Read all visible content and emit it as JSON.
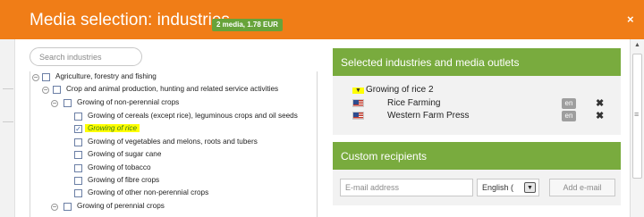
{
  "header": {
    "title": "Media selection: industries",
    "badge": "2 media, 1.78 EUR",
    "close_glyph": "×",
    "background_color": "#f07d17"
  },
  "search": {
    "placeholder": "Search industries"
  },
  "tree": {
    "expand_glyph": "−",
    "check_glyph": "✓",
    "nodes": [
      {
        "label": "Agriculture, forestry and fishing",
        "expander": true,
        "checked": false,
        "selected": false
      },
      {
        "label": "Crop and animal production, hunting and related service activities",
        "expander": true,
        "checked": false,
        "selected": false
      },
      {
        "label": "Growing of non-perennial crops",
        "expander": true,
        "checked": false,
        "selected": false
      },
      {
        "label": "Growing of cereals (except rice), leguminous crops and oil seeds",
        "expander": false,
        "checked": false,
        "selected": false
      },
      {
        "label": "Growing of rice",
        "expander": false,
        "checked": true,
        "selected": true
      },
      {
        "label": "Growing of vegetables and melons, roots and tubers",
        "expander": false,
        "checked": false,
        "selected": false
      },
      {
        "label": "Growing of sugar cane",
        "expander": false,
        "checked": false,
        "selected": false
      },
      {
        "label": "Growing of tobacco",
        "expander": false,
        "checked": false,
        "selected": false
      },
      {
        "label": "Growing of fibre crops",
        "expander": false,
        "checked": false,
        "selected": false
      },
      {
        "label": "Growing of other non-perennial crops",
        "expander": false,
        "checked": false,
        "selected": false
      },
      {
        "label": "Growing of perennial crops",
        "expander": true,
        "checked": false,
        "selected": false
      }
    ]
  },
  "selected_panel": {
    "title": "Selected industries and media outlets",
    "group_marker": "▼",
    "group_label": "Growing of rice 2",
    "outlets": [
      {
        "name": "Rice Farming",
        "lang": "en",
        "remove_glyph": "✖"
      },
      {
        "name": "Western Farm Press",
        "lang": "en",
        "remove_glyph": "✖"
      }
    ]
  },
  "custom_panel": {
    "title": "Custom recipients",
    "email_placeholder": "E-mail address",
    "language_value": "English (",
    "language_arrow": "▼",
    "add_button": "Add e-mail"
  },
  "scrollbar": {
    "up_glyph": "▲",
    "grip_glyph": "≡"
  },
  "colors": {
    "accent_orange": "#f07d17",
    "panel_green": "#79ab3e",
    "badge_green": "#67a33a",
    "highlight_yellow": "#ffff00"
  }
}
